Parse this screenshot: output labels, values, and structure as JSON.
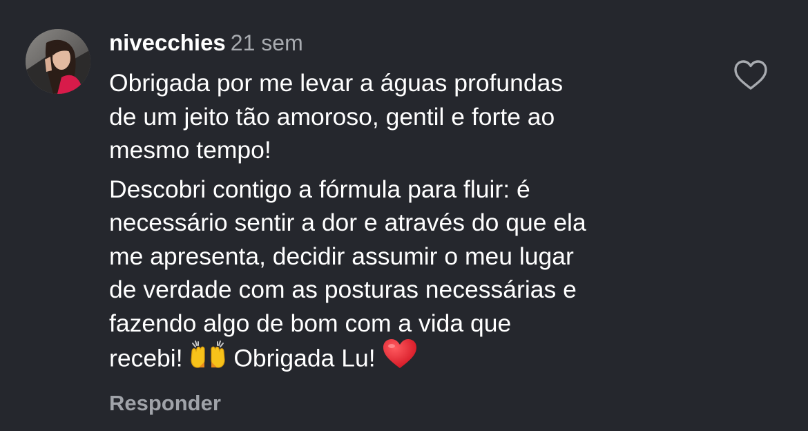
{
  "comment": {
    "username": "nivecchies",
    "time": "21 sem",
    "paragraph_1": "Obrigada por me levar a águas profundas\nde um jeito tão amoroso, gentil e forte ao\nmesmo tempo!",
    "paragraph_2": "Descobri contigo a fórmula para fluir: é\nnecessário sentir a dor e através do que ela\nme apresenta, decidir assumir o meu lugar\nde verdade com as posturas necessárias e\nfazendo algo de bom com a vida que\nrecebi!",
    "paragraph_2_end": "Obrigada Lu!",
    "emojis": [
      "raising-hands-emoji",
      "red-heart-emoji"
    ],
    "reply_label": "Responder",
    "like_icon": "heart-outline-icon"
  },
  "colors": {
    "background": "#25272d",
    "text": "#ffffff",
    "muted": "#a8abb0",
    "heart_emoji": "#e0202e",
    "hands_emoji": "#f7c21a"
  }
}
